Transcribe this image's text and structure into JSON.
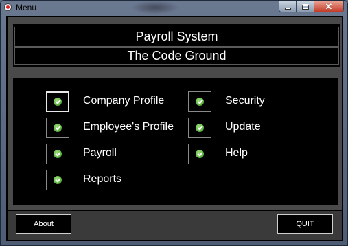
{
  "window": {
    "title": "Menu",
    "app_icon": "app-record-icon",
    "minimize_icon": "minimize-icon",
    "maximize_icon": "maximize-icon",
    "close_icon": "close-icon"
  },
  "header": {
    "title": "Payroll System",
    "subtitle": "The Code Ground"
  },
  "menu": {
    "check_icon": "check-circle-icon",
    "check_color": "#4caf2a",
    "items": [
      {
        "label": "Company Profile",
        "selected": true
      },
      {
        "label": "Employee's Profile",
        "selected": false
      },
      {
        "label": "Payroll",
        "selected": false
      },
      {
        "label": "Reports",
        "selected": false
      },
      {
        "label": "Security",
        "selected": false
      },
      {
        "label": "Update",
        "selected": false
      },
      {
        "label": "Help",
        "selected": false
      }
    ]
  },
  "footer": {
    "about_label": "About",
    "quit_label": "QUIT"
  }
}
